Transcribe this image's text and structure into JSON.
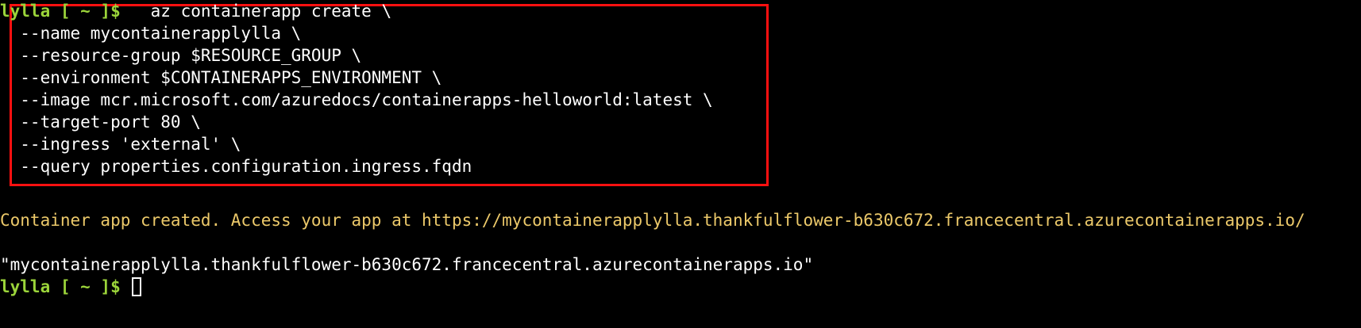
{
  "terminal": {
    "prompt": "lylla [ ~ ]$",
    "command_lines": [
      "   az containerapp create \\",
      "  --name mycontainerapplylla \\",
      "  --resource-group $RESOURCE_GROUP \\",
      "  --environment $CONTAINERAPPS_ENVIRONMENT \\",
      "  --image mcr.microsoft.com/azuredocs/containerapps-helloworld:latest \\",
      "  --target-port 80 \\",
      "  --ingress 'external' \\",
      "  --query properties.configuration.ingress.fqdn"
    ],
    "status_message": "Container app created. Access your app at https://mycontainerapplylla.thankfulflower-b630c672.francecentral.azurecontainerapps.io/",
    "output_value": "\"mycontainerapplylla.thankfulflower-b630c672.francecentral.azurecontainerapps.io\"",
    "final_prompt": "lylla [ ~ ]$"
  },
  "colors": {
    "background": "#000000",
    "prompt": "#9bd43a",
    "warning_text": "#ecc96a",
    "highlight_border": "#ff1010"
  }
}
